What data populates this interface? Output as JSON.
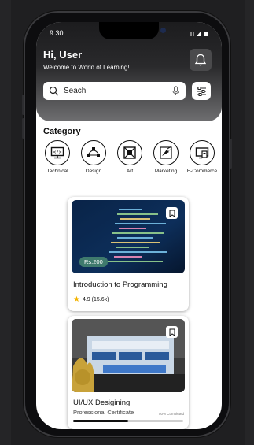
{
  "status_bar": {
    "time": "9:30"
  },
  "header": {
    "greeting": "Hi, User",
    "welcome": "Welcome to World of Learning!",
    "bell_icon": "bell-icon"
  },
  "search": {
    "placeholder": "Seach",
    "mic_icon": "mic-icon",
    "filter_icon": "filter-icon"
  },
  "category": {
    "title": "Category",
    "items": [
      {
        "label": "Technical",
        "icon": "monitor-code-icon"
      },
      {
        "label": "Design",
        "icon": "vector-nodes-icon"
      },
      {
        "label": "Art",
        "icon": "canvas-art-icon"
      },
      {
        "label": "Marketing",
        "icon": "megaphone-icon"
      },
      {
        "label": "E-Commerce",
        "icon": "ecommerce-icon"
      }
    ]
  },
  "courses": [
    {
      "price": "Rs.200",
      "title": "Introduction to Programming",
      "rating": "4.9 (15.6k)"
    },
    {
      "title": "UI/UX Desigining",
      "subtitle": "Professional Certificate",
      "progress_text": "50% Completed",
      "progress": 0.5
    }
  ],
  "colors": {
    "price_badge": "#3f7a6d",
    "star": "#f4b400"
  }
}
